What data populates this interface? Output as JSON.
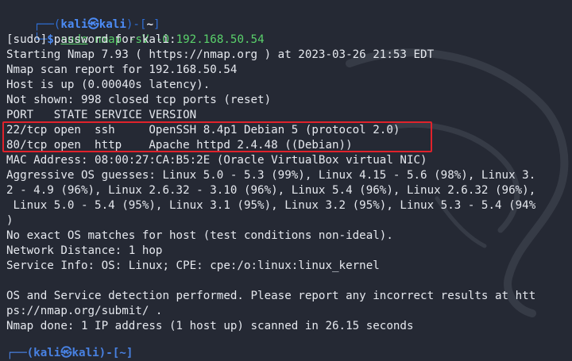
{
  "prompt": {
    "frame_top": "┌──(",
    "user": "kali㉿kali",
    "frame_mid": ")-[",
    "cwd": "~",
    "frame_end": "]",
    "frame_bottom": "└─",
    "dollar": "$ ",
    "command_sudo": "sudo",
    "command_rest": " nmap -sV -O 192.168.50.54"
  },
  "output_lines": [
    "[sudo] password for kali:",
    "Starting Nmap 7.93 ( https://nmap.org ) at 2023-03-26 21:53 EDT",
    "Nmap scan report for 192.168.50.54",
    "Host is up (0.00040s latency).",
    "Not shown: 998 closed tcp ports (reset)",
    "PORT   STATE SERVICE VERSION",
    "22/tcp open  ssh     OpenSSH 8.4p1 Debian 5 (protocol 2.0)",
    "80/tcp open  http    Apache httpd 2.4.48 ((Debian))",
    "MAC Address: 08:00:27:CA:B5:2E (Oracle VirtualBox virtual NIC)",
    "Aggressive OS guesses: Linux 5.0 - 5.3 (99%), Linux 4.15 - 5.6 (98%), Linux 3.",
    "2 - 4.9 (96%), Linux 2.6.32 - 3.10 (96%), Linux 5.4 (96%), Linux 2.6.32 (96%),",
    " Linux 5.0 - 5.4 (95%), Linux 3.1 (95%), Linux 3.2 (95%), Linux 5.3 - 5.4 (94%",
    ")",
    "No exact OS matches for host (test conditions non-ideal).",
    "Network Distance: 1 hop",
    "Service Info: OS: Linux; CPE: cpe:/o:linux:linux_kernel",
    "",
    "OS and Service detection performed. Please report any incorrect results at htt",
    "ps://nmap.org/submit/ .",
    "Nmap done: 1 IP address (1 host up) scanned in 26.15 seconds"
  ],
  "cut_prompt": "┌──(kali㉿kali)-[~]",
  "colors": {
    "background": "#252934",
    "text": "#e5e8ee",
    "prompt_blue": "#4c8bf5",
    "command_green": "#5ad16b",
    "highlight_red": "#e0222b"
  }
}
